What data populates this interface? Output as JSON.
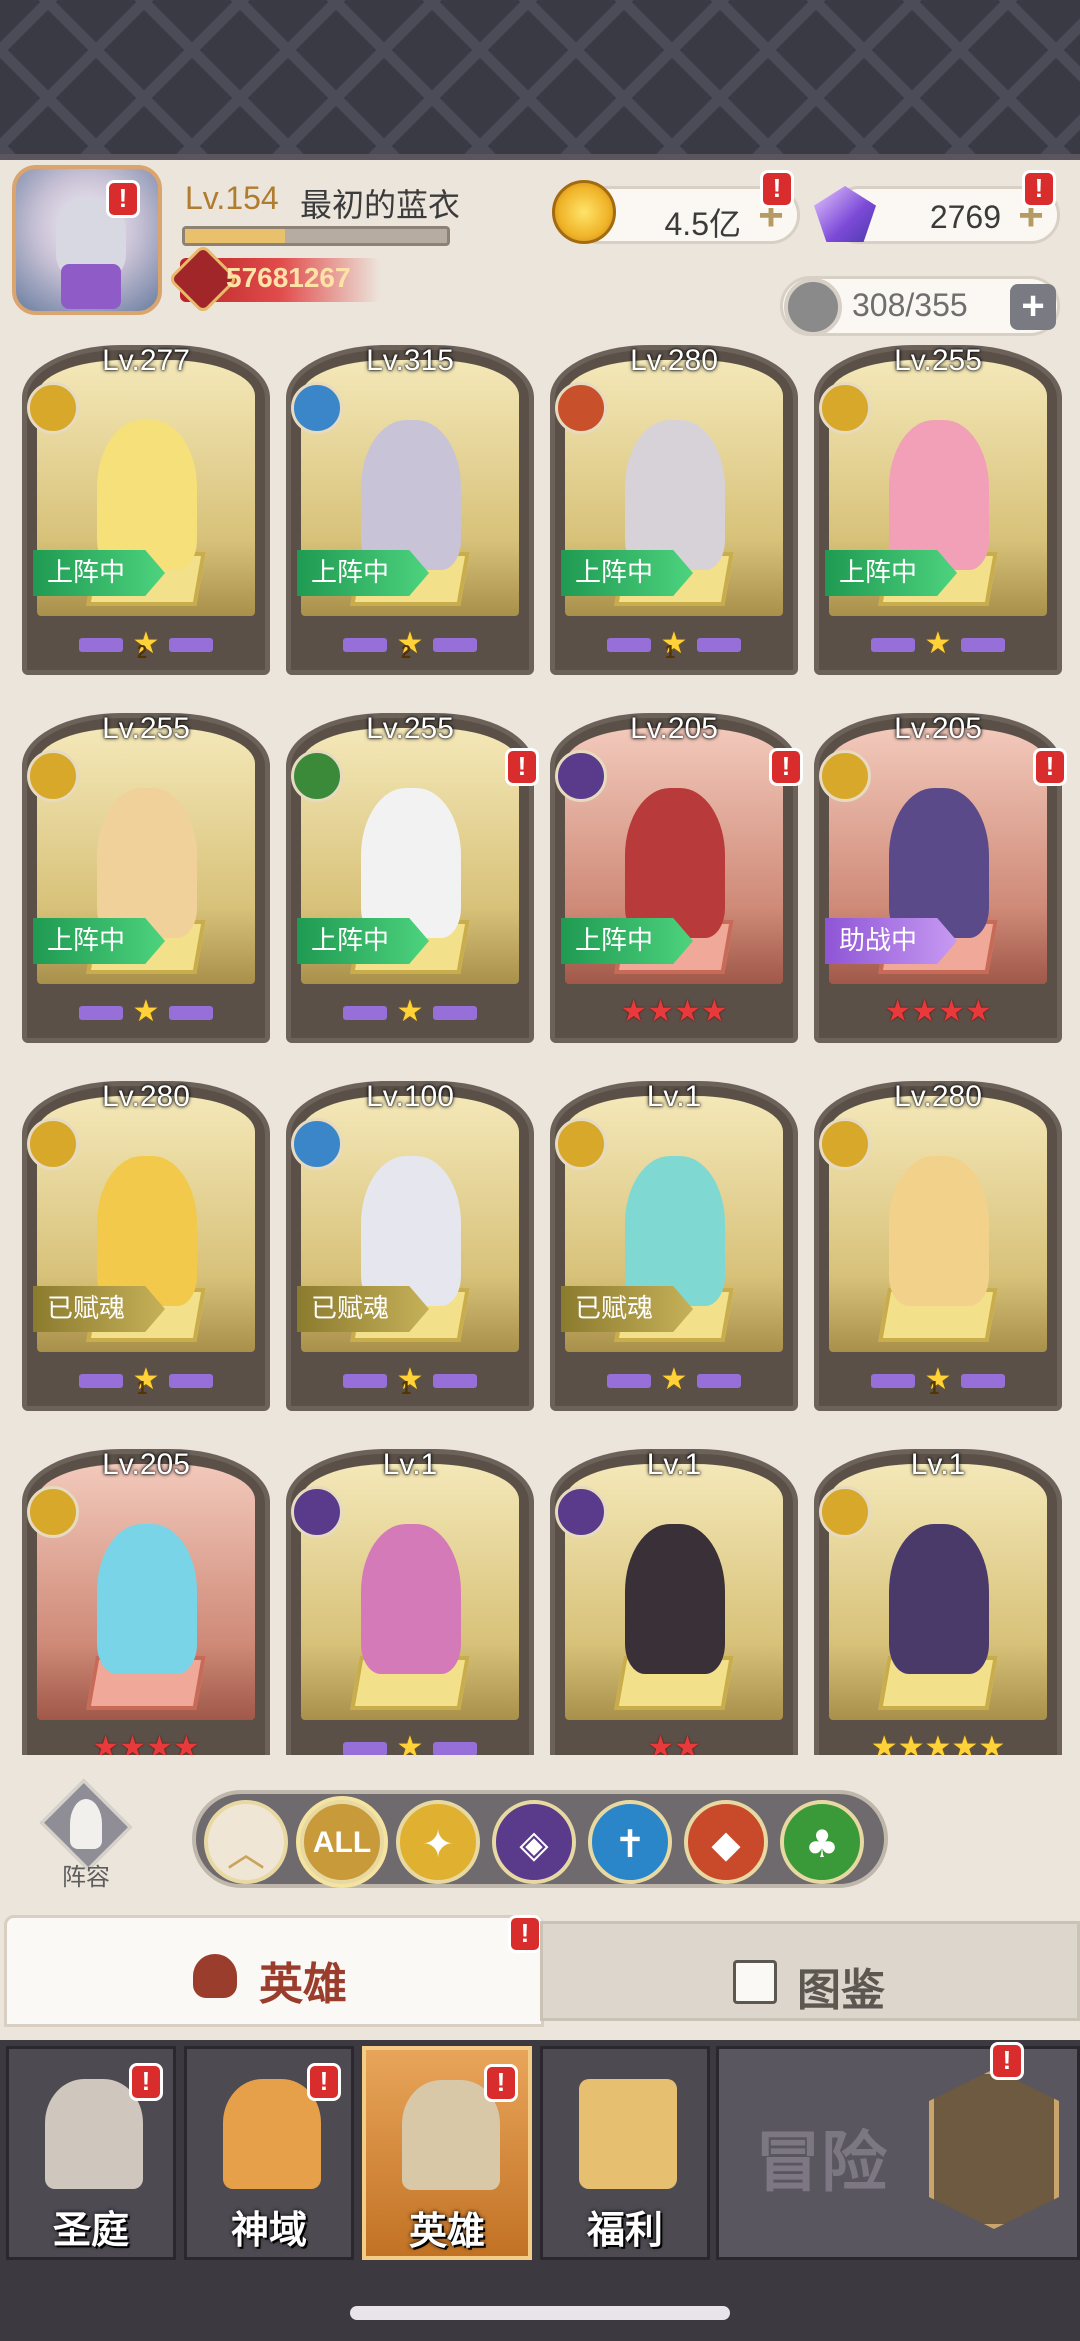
{
  "player": {
    "level": "Lv.154",
    "name": "最初的蓝衣",
    "power": "57681267",
    "exp_fraction": 0.38
  },
  "currencies": {
    "gold": "4.5亿",
    "gems": "2769"
  },
  "roster": {
    "count": "308/355",
    "plus": "+"
  },
  "badge_mark": "!",
  "heroes": [
    {
      "level": "Lv.277",
      "faction": "light",
      "tag": "上阵中",
      "tag_type": "on",
      "stars": "2",
      "star_type": "wing",
      "bg": "gold",
      "figure_color": "#f5e07a"
    },
    {
      "level": "Lv.315",
      "faction": "ice",
      "tag": "上阵中",
      "tag_type": "on",
      "stars": "2",
      "star_type": "wing",
      "bg": "gold",
      "figure_color": "#c9c3d8"
    },
    {
      "level": "Lv.280",
      "faction": "fire",
      "tag": "上阵中",
      "tag_type": "on",
      "stars": "1",
      "star_type": "wing",
      "bg": "gold",
      "figure_color": "#d7d2d8"
    },
    {
      "level": "Lv.255",
      "faction": "light",
      "tag": "上阵中",
      "tag_type": "on",
      "stars": "",
      "star_type": "wing",
      "bg": "gold",
      "figure_color": "#f1a0b8"
    },
    {
      "level": "Lv.255",
      "faction": "light",
      "tag": "上阵中",
      "tag_type": "on",
      "stars": "",
      "star_type": "wing",
      "bg": "gold",
      "figure_color": "#f0d19a"
    },
    {
      "level": "Lv.255",
      "faction": "nature",
      "tag": "上阵中",
      "tag_type": "on",
      "stars": "",
      "star_type": "wing",
      "bg": "gold",
      "figure_color": "#f2f2f2",
      "badge": true
    },
    {
      "level": "Lv.205",
      "faction": "dark",
      "tag": "上阵中",
      "tag_type": "on",
      "stars": "★★★★",
      "star_type": "red",
      "bg": "red",
      "figure_color": "#b83a3a",
      "badge": true
    },
    {
      "level": "Lv.205",
      "faction": "light",
      "tag": "助战中",
      "tag_type": "help",
      "stars": "★★★★",
      "star_type": "red",
      "bg": "red",
      "figure_color": "#5a4a8a",
      "badge": true
    },
    {
      "level": "Lv.280",
      "faction": "light",
      "tag": "已赋魂",
      "tag_type": "soul",
      "stars": "1",
      "star_type": "wing",
      "bg": "gold",
      "figure_color": "#f2c94a"
    },
    {
      "level": "Lv.100",
      "faction": "ice",
      "tag": "已赋魂",
      "tag_type": "soul",
      "stars": "1",
      "star_type": "wing",
      "bg": "gold",
      "figure_color": "#e6e6ef"
    },
    {
      "level": "Lv.1",
      "faction": "light",
      "tag": "已赋魂",
      "tag_type": "soul",
      "stars": "",
      "star_type": "wing",
      "bg": "gold",
      "figure_color": "#7fd9d2"
    },
    {
      "level": "Lv.280",
      "faction": "light",
      "tag": "",
      "tag_type": "",
      "stars": "1",
      "star_type": "wing",
      "bg": "gold",
      "figure_color": "#f2d28a"
    },
    {
      "level": "Lv.205",
      "faction": "light",
      "tag": "",
      "tag_type": "",
      "stars": "★★★★",
      "star_type": "red",
      "bg": "red",
      "figure_color": "#7ad4e8"
    },
    {
      "level": "Lv.1",
      "faction": "dark",
      "tag": "",
      "tag_type": "",
      "stars": "",
      "star_type": "wing",
      "bg": "gold",
      "figure_color": "#d47ab8"
    },
    {
      "level": "Lv.1",
      "faction": "dark",
      "tag": "",
      "tag_type": "",
      "stars": "★★",
      "star_type": "red",
      "bg": "gold",
      "figure_color": "#3a3038"
    },
    {
      "level": "Lv.1",
      "faction": "light",
      "tag": "",
      "tag_type": "",
      "stars": "★★★★★",
      "star_type": "gold",
      "bg": "gold",
      "figure_color": "#4a3a6a"
    }
  ],
  "faction_colors": {
    "light": "#d8a82a",
    "ice": "#3a86c8",
    "fire": "#c8502a",
    "nature": "#3a8a3a",
    "dark": "#5a3a8a"
  },
  "lineup_label": "阵容",
  "filters": [
    {
      "name": "up-arrow",
      "glyph": "︿",
      "color": "#efe6d6"
    },
    {
      "name": "all",
      "glyph": "ALL",
      "color": "#c89a3a"
    },
    {
      "name": "light",
      "glyph": "✦",
      "color": "#e0b030"
    },
    {
      "name": "dark",
      "glyph": "◈",
      "color": "#5a3a8a"
    },
    {
      "name": "ice",
      "glyph": "✝",
      "color": "#2a86c8"
    },
    {
      "name": "fire",
      "glyph": "◆",
      "color": "#c84a2a"
    },
    {
      "name": "nature",
      "glyph": "♣",
      "color": "#3a9a3a"
    }
  ],
  "tabs": {
    "hero": "英雄",
    "codex": "图鉴"
  },
  "nav": [
    {
      "label": "圣庭",
      "icon": "sanctum-icon"
    },
    {
      "label": "神域",
      "icon": "divine-realm-icon"
    },
    {
      "label": "英雄",
      "icon": "hero-helmet-icon"
    },
    {
      "label": "福利",
      "icon": "treasure-chest-icon"
    }
  ],
  "adventure_label": "冒险"
}
